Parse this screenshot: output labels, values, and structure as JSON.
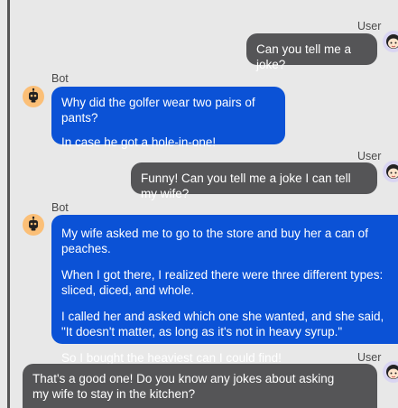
{
  "conversation": {
    "messages": [
      {
        "role": "user",
        "sender": "User",
        "avatar": "girl-face-icon",
        "paragraphs": [
          "Can you tell me a joke?"
        ]
      },
      {
        "role": "bot",
        "sender": "Bot",
        "avatar": "robot-face-icon",
        "paragraphs": [
          "Why did the golfer wear two pairs of pants?",
          "In case he got a hole-in-one!"
        ]
      },
      {
        "role": "user",
        "sender": "User",
        "avatar": "girl-face-icon",
        "paragraphs": [
          "Funny! Can you tell me a joke I can tell my wife?"
        ]
      },
      {
        "role": "bot",
        "sender": "Bot",
        "avatar": "robot-face-icon",
        "paragraphs": [
          "My wife asked me to go to the store and buy her a can of peaches.",
          "When I got there, I realized there were three different types: sliced, diced, and whole.",
          "I called her and asked which one she wanted, and she said, \"It doesn't matter, as long as it's not in heavy syrup.\"",
          "So I bought the heaviest can I could find!"
        ]
      },
      {
        "role": "user",
        "sender": "User",
        "avatar": "girl-face-icon",
        "paragraphs": [
          "That's a good one! Do you know any jokes about asking my wife to stay in the kitchen?"
        ]
      }
    ]
  },
  "colors": {
    "background": "#e8e8e8",
    "user_bubble": "#555557",
    "bot_bubble": "#0b52d6",
    "user_avatar": "#d9d5f2",
    "bot_avatar": "#fbbf77"
  }
}
